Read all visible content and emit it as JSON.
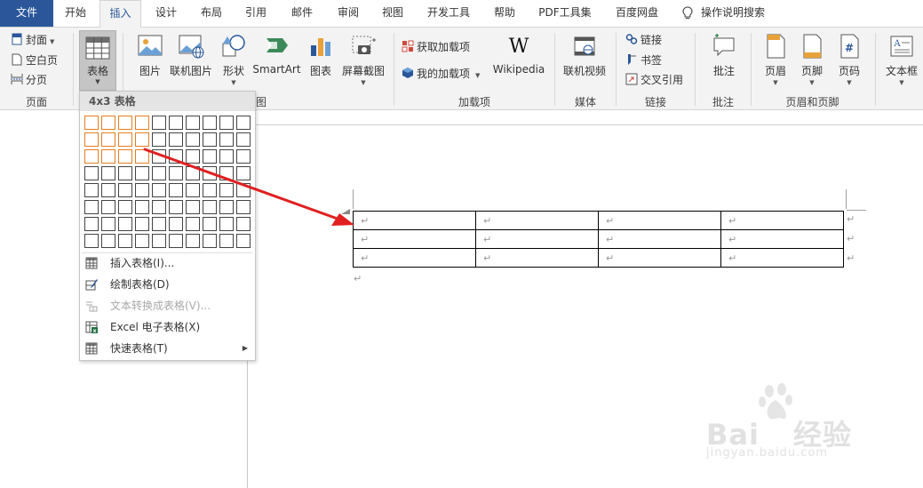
{
  "tabs": [
    {
      "label": "文件"
    },
    {
      "label": "开始"
    },
    {
      "label": "插入"
    },
    {
      "label": "设计"
    },
    {
      "label": "布局"
    },
    {
      "label": "引用"
    },
    {
      "label": "邮件"
    },
    {
      "label": "审阅"
    },
    {
      "label": "视图"
    },
    {
      "label": "开发工具"
    },
    {
      "label": "帮助"
    },
    {
      "label": "PDF工具集"
    },
    {
      "label": "百度网盘"
    }
  ],
  "active_tab": "插入",
  "tell_me": "操作说明搜索",
  "ribbon": {
    "pages": {
      "cover": "封面",
      "blank": "空白页",
      "break": "分页",
      "group_label": "页面"
    },
    "table": {
      "label": "表格"
    },
    "illustrations": {
      "picture": "图片",
      "online_picture": "联机图片",
      "shapes": "形状",
      "smartart": "SmartArt",
      "chart": "图表",
      "screenshot": "屏幕截图",
      "group_label_partial": "图"
    },
    "addins": {
      "get": "获取加载项",
      "my": "我的加载项",
      "wikipedia": "Wikipedia",
      "group_label": "加载项"
    },
    "media": {
      "video": "联机视频",
      "group_label": "媒体"
    },
    "links": {
      "link": "链接",
      "bookmark": "书签",
      "cross_ref": "交叉引用",
      "group_label": "链接"
    },
    "comments": {
      "comment": "批注",
      "group_label": "批注"
    },
    "header_footer": {
      "header": "页眉",
      "footer": "页脚",
      "page_number": "页码",
      "group_label": "页眉和页脚"
    },
    "text": {
      "textbox": "文本框"
    }
  },
  "dropdown": {
    "header": "4x3 表格",
    "grid": {
      "columns": 10,
      "rows": 8,
      "selected_columns": 4,
      "selected_rows": 3
    },
    "items": [
      {
        "label": "插入表格(I)...",
        "icon": "insert-table-icon",
        "enabled": true
      },
      {
        "label": "绘制表格(D)",
        "icon": "draw-table-icon",
        "enabled": true
      },
      {
        "label": "文本转换成表格(V)...",
        "icon": "text-to-table-icon",
        "enabled": false
      },
      {
        "label": "Excel 电子表格(X)",
        "icon": "excel-icon",
        "enabled": true
      },
      {
        "label": "快速表格(T)",
        "icon": "quick-table-icon",
        "enabled": true
      }
    ]
  },
  "document": {
    "table": {
      "rows": 3,
      "columns": 4,
      "cell_mark": "↵"
    },
    "paragraph_mark": "↵"
  },
  "colors": {
    "file_tab": "#2b579a",
    "grid_selected": "#e67e22",
    "arrow": "#e02020"
  },
  "watermark": {
    "logo": "Bai du 经验",
    "url": "jingyan.baidu.com"
  }
}
